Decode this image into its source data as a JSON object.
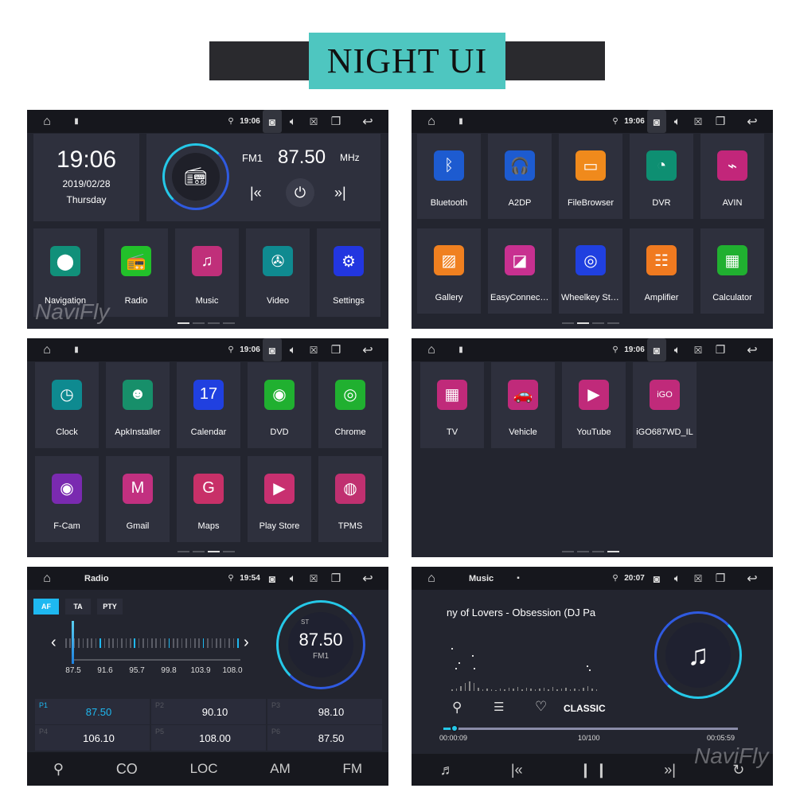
{
  "banner": {
    "title": "NIGHT UI"
  },
  "watermark": "NaviFly",
  "status_icons": {
    "home": "home-icon",
    "sd": "sd-card-icon",
    "location": "location-pin-icon",
    "camera": "camera-icon",
    "volume": "volume-icon",
    "close": "close-box-icon",
    "windows": "recent-apps-icon",
    "back": "back-icon"
  },
  "panels": [
    {
      "time": "19:06",
      "title": "",
      "show_sd": true
    },
    {
      "time": "19:06",
      "title": "",
      "show_sd": true
    },
    {
      "time": "19:06",
      "title": "",
      "show_sd": true
    },
    {
      "time": "19:06",
      "title": "",
      "show_sd": true
    },
    {
      "time": "19:54",
      "title": "Radio",
      "show_sd": false
    },
    {
      "time": "20:07",
      "title": "Music",
      "show_sd": false
    }
  ],
  "home": {
    "clock": {
      "time": "19:06",
      "date": "2019/02/28",
      "day": "Thursday"
    },
    "radio_widget": {
      "band": "FM1",
      "freq": "87.50",
      "unit": "MHz"
    },
    "apps": [
      {
        "label": "Navigation",
        "color": "#11907a",
        "glyph": "⬤"
      },
      {
        "label": "Radio",
        "color": "#22c02a",
        "glyph": "📻"
      },
      {
        "label": "Music",
        "color": "#c02f7a",
        "glyph": "♫"
      },
      {
        "label": "Video",
        "color": "#0f8a90",
        "glyph": "✇"
      },
      {
        "label": "Settings",
        "color": "#2236e0",
        "glyph": "⚙"
      }
    ],
    "page": 0,
    "pages": 4
  },
  "apps_page1": {
    "apps": [
      {
        "label": "Bluetooth",
        "color": "#1d5bd0",
        "glyph": "ᛒ"
      },
      {
        "label": "A2DP",
        "color": "#1d5bd0",
        "glyph": "🎧"
      },
      {
        "label": "FileBrowser",
        "color": "#f08a1c",
        "glyph": "▭"
      },
      {
        "label": "DVR",
        "color": "#0e8f72",
        "glyph": "◔"
      },
      {
        "label": "AVIN",
        "color": "#c2267a",
        "glyph": "⌁"
      },
      {
        "label": "Gallery",
        "color": "#f08020",
        "glyph": "▨"
      },
      {
        "label": "EasyConnecti...",
        "color": "#c83090",
        "glyph": "◪"
      },
      {
        "label": "Wheelkey Stu...",
        "color": "#2040e0",
        "glyph": "◎"
      },
      {
        "label": "Amplifier",
        "color": "#f07a20",
        "glyph": "☷"
      },
      {
        "label": "Calculator",
        "color": "#20b030",
        "glyph": "▦"
      }
    ],
    "page": 1,
    "pages": 4
  },
  "apps_page2": {
    "apps": [
      {
        "label": "Clock",
        "color": "#0e8a90",
        "glyph": "◷"
      },
      {
        "label": "ApkInstaller",
        "color": "#178f6a",
        "glyph": "☻"
      },
      {
        "label": "Calendar",
        "color": "#2040e0",
        "glyph": "17"
      },
      {
        "label": "DVD",
        "color": "#20b030",
        "glyph": "◉"
      },
      {
        "label": "Chrome",
        "color": "#20b030",
        "glyph": "◎"
      },
      {
        "label": "F-Cam",
        "color": "#7a2ab0",
        "glyph": "◉"
      },
      {
        "label": "Gmail",
        "color": "#c23080",
        "glyph": "M"
      },
      {
        "label": "Maps",
        "color": "#c83068",
        "glyph": "G"
      },
      {
        "label": "Play Store",
        "color": "#c83070",
        "glyph": "▶"
      },
      {
        "label": "TPMS",
        "color": "#c03070",
        "glyph": "◍"
      }
    ],
    "page": 2,
    "pages": 4
  },
  "apps_page3": {
    "apps": [
      {
        "label": "TV",
        "color": "#c02a7a",
        "glyph": "▦"
      },
      {
        "label": "Vehicle",
        "color": "#c02a7a",
        "glyph": "🚗"
      },
      {
        "label": "YouTube",
        "color": "#c02a7a",
        "glyph": "▶"
      },
      {
        "label": "iGO687WD_IL",
        "color": "#c02a7a",
        "glyph": "iGO"
      }
    ],
    "page": 3,
    "pages": 4
  },
  "radio": {
    "buttons": [
      {
        "label": "AF",
        "active": true
      },
      {
        "label": "TA",
        "active": false
      },
      {
        "label": "PTY",
        "active": false
      }
    ],
    "scale_labels": [
      "87.5",
      "91.6",
      "95.7",
      "99.8",
      "103.9",
      "108.0"
    ],
    "freq_min": 87.5,
    "freq_max": 108.0,
    "current": 87.5,
    "dial": {
      "stereo": "ST",
      "freq": "87.50",
      "band": "FM1"
    },
    "presets": [
      {
        "slot": "P1",
        "freq": "87.50",
        "active": true
      },
      {
        "slot": "P2",
        "freq": "90.10",
        "active": false
      },
      {
        "slot": "P3",
        "freq": "98.10",
        "active": false
      },
      {
        "slot": "P4",
        "freq": "106.10",
        "active": false
      },
      {
        "slot": "P5",
        "freq": "108.00",
        "active": false
      },
      {
        "slot": "P6",
        "freq": "87.50",
        "active": false
      }
    ],
    "bottom": [
      {
        "label": "",
        "icon": "search-icon",
        "glyph": "⚲"
      },
      {
        "label": "",
        "icon": "stereo-icon",
        "glyph": "CO"
      },
      {
        "label": "LOC"
      },
      {
        "label": "AM"
      },
      {
        "label": "FM"
      }
    ],
    "accent": "#1eb8f0"
  },
  "music": {
    "title": "ny of Lovers - Obsession (DJ Pa",
    "eq_preset": "CLASSIC",
    "elapsed": "00:00:09",
    "track": "10/100",
    "total": "00:05:59",
    "progress": 0.025
  }
}
